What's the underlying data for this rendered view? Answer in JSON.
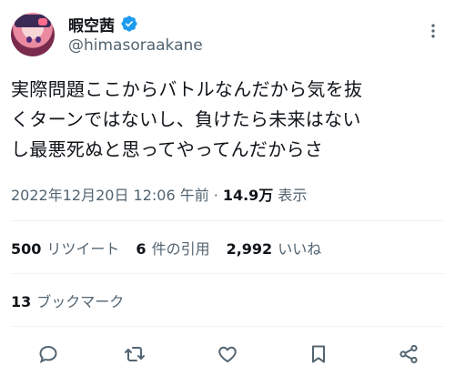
{
  "author": {
    "display_name": "暇空茜",
    "handle": "@himasoraakane"
  },
  "tweet": {
    "text": "実際問題ここからバトルなんだから気を抜\nくターンではないし、負けたら未来はない\nし最悪死ぬと思ってやってんだからさ"
  },
  "meta": {
    "date": "2022年12月20日 12:06 午前",
    "separator": "·",
    "views_count": "14.9万",
    "views_label": "表示"
  },
  "stats": {
    "retweets_count": "500",
    "retweets_label": "リツイート",
    "quotes_count": "6",
    "quotes_label": "件の引用",
    "likes_count": "2,992",
    "likes_label": "いいね"
  },
  "bookmarks": {
    "count": "13",
    "label": "ブックマーク"
  },
  "colors": {
    "text_primary": "#0f1419",
    "text_secondary": "#536471",
    "verified": "#1d9bf0",
    "divider": "#eff3f4"
  },
  "icons": [
    "verified-badge-icon",
    "more-icon",
    "reply-icon",
    "retweet-icon",
    "like-icon",
    "bookmark-icon",
    "share-icon"
  ]
}
